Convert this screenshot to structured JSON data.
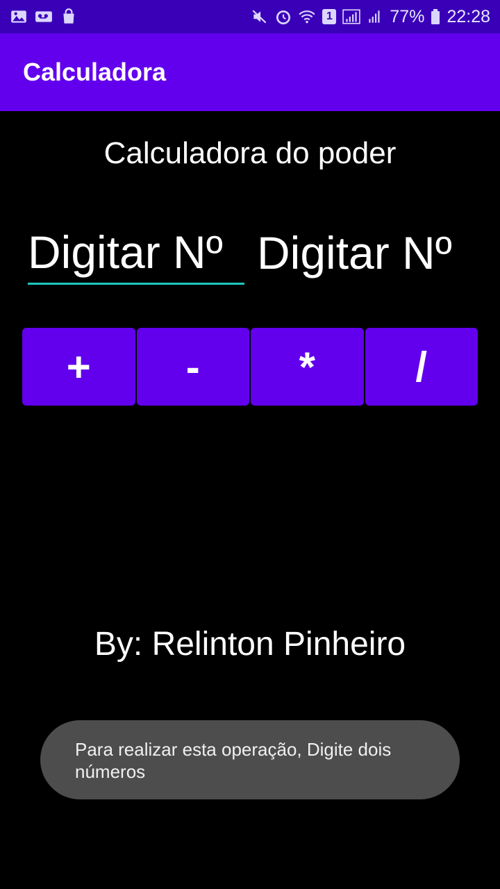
{
  "status_bar": {
    "battery_percent": "77%",
    "time": "22:28",
    "sim_badge": "1"
  },
  "app_bar": {
    "title": "Calculadora"
  },
  "main": {
    "heading": "Calculadora do poder",
    "input1_placeholder": "Digitar Nº",
    "input2_placeholder": "Digitar Nº",
    "operations": [
      "+",
      "-",
      "*",
      "/"
    ],
    "author": "By: Relinton Pinheiro"
  },
  "toast": {
    "message": "Para realizar esta operação, Digite dois números"
  },
  "colors": {
    "status_bar": "#3a00b8",
    "app_bar": "#6200ee",
    "button": "#6200ee",
    "input_underline": "#1ec8bf",
    "toast_bg": "#4d4d4d"
  }
}
